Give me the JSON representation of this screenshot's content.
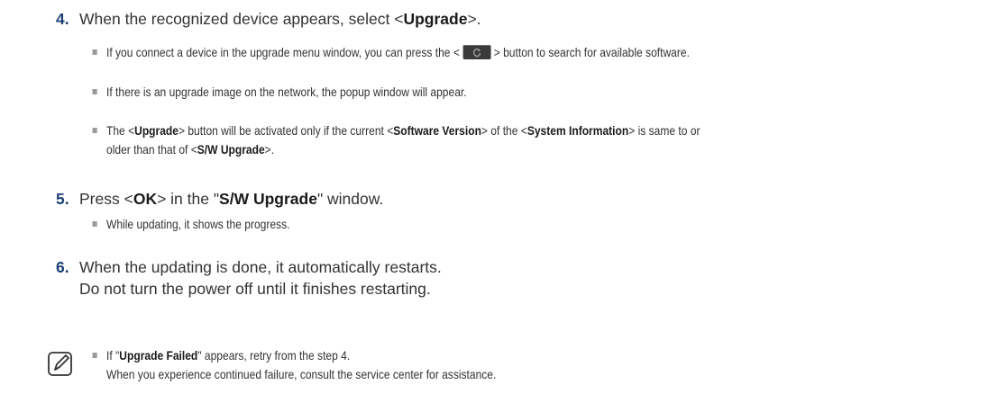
{
  "step4": {
    "num": "4.",
    "pre": "When the recognized device appears, select <",
    "bold": "Upgrade",
    "post": ">.",
    "bullets": {
      "b1_pre": "If you connect a device in the upgrade menu window, you can press the <",
      "b1_post": "> button to search for available software.",
      "b2": "If there is an upgrade image on the network, the popup window will appear.",
      "b3_a": "The <",
      "b3_b": "Upgrade",
      "b3_c": "> button will be activated only if the current <",
      "b3_d": "Software Version",
      "b3_e": "> of the <",
      "b3_f": "System Information",
      "b3_g": "> is same to or",
      "b3_h": "older than that of <",
      "b3_i": "S/W Upgrade",
      "b3_j": ">."
    }
  },
  "step5": {
    "num": "5.",
    "pre": "Press <",
    "bold1": "OK",
    "mid": "> in the \"",
    "bold2": "S/W Upgrade",
    "post": "\" window.",
    "bullet": "While updating, it shows the progress."
  },
  "step6": {
    "num": "6.",
    "line1": "When the updating is done, it automatically restarts.",
    "line2": "Do not turn the power off until it finishes restarting."
  },
  "note": {
    "pre": "If \"",
    "bold": "Upgrade Failed",
    "post": "\" appears, retry from the step 4.",
    "line2": "When you experience continued failure, consult the service center for assistance."
  },
  "icons": {
    "refresh": "refresh-icon",
    "note": "note-pencil-icon"
  }
}
